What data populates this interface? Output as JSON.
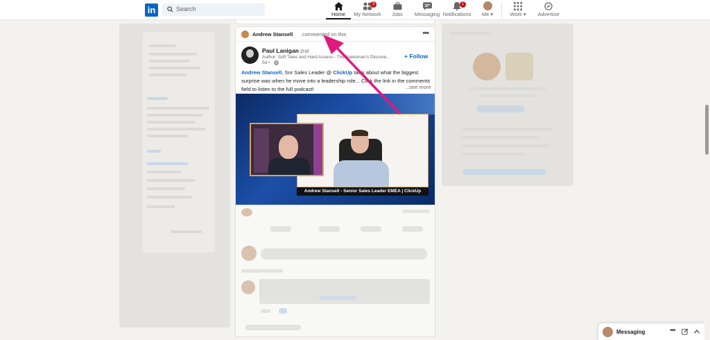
{
  "search": {
    "placeholder": "Search"
  },
  "nav": [
    {
      "id": "home",
      "label": "Home",
      "icon": "home-icon",
      "active": true
    },
    {
      "id": "network",
      "label": "My Network",
      "icon": "people-icon",
      "badge": "3"
    },
    {
      "id": "jobs",
      "label": "Jobs",
      "icon": "briefcase-icon"
    },
    {
      "id": "messaging",
      "label": "Messaging",
      "icon": "chat-icon"
    },
    {
      "id": "notifications",
      "label": "Notifications",
      "icon": "bell-icon",
      "badge": "1"
    },
    {
      "id": "me",
      "label": "Me",
      "icon": "avatar"
    },
    {
      "id": "work",
      "label": "Work",
      "icon": "grid-icon"
    },
    {
      "id": "advertise",
      "label": "Advertise",
      "icon": "compass-icon"
    }
  ],
  "post": {
    "context_name": "Andrew Stansell",
    "context_action": "commented on this",
    "author_name": "Paul Lanigan",
    "author_degree": "• 2nd",
    "author_title": "Author: Soft Tales and Hard Assess - The Salesman's Discove...",
    "time": "5d •",
    "follow_label": "+ Follow",
    "text_mention1": "Andrew Stansell",
    "text_part1": ", Snr Sales Leader @ ",
    "text_mention2": "ClickUp",
    "text_part2": " talks about what the biggest surprise was when he move into a leadership role... Click the link in the comments field to listen to the full podcast!",
    "see_more": "...see more",
    "video_caption": "Andrew Stansell - Senior Sales Leader EMEA | ClickUp"
  },
  "messaging": {
    "label": "Messaging"
  },
  "colors": {
    "brand": "#0a66c2",
    "badge": "#cc1016",
    "annotation_arrow": "#e0197d"
  }
}
